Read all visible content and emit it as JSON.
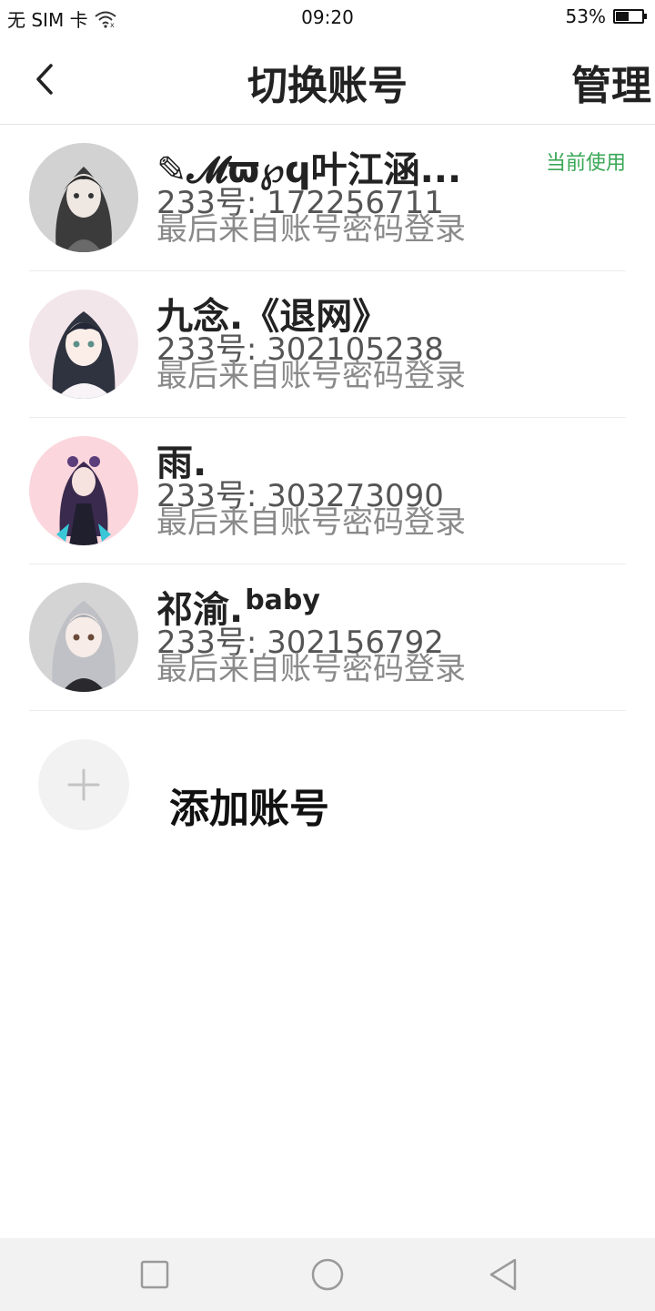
{
  "status_bar": {
    "carrier": "无 SIM 卡",
    "time": "09:20",
    "battery_percent": "53%",
    "battery_level": 0.53
  },
  "nav": {
    "title": "切换账号",
    "manage_label": "管理"
  },
  "accounts": [
    {
      "name": "✎𝓜ϖ℘ϥ叶江涵...",
      "name_sup": "",
      "id_line": "233号: 172256711",
      "login_line": "最后来自账号密码登录",
      "badge": "当前使用"
    },
    {
      "name": "九念.《退网》",
      "name_sup": "",
      "id_line": "233号: 302105238",
      "login_line": "最后来自账号密码登录",
      "badge": ""
    },
    {
      "name": "雨.",
      "name_sup": "",
      "id_line": "233号: 303273090",
      "login_line": "最后来自账号密码登录",
      "badge": ""
    },
    {
      "name": "祁渝.",
      "name_sup": "baby",
      "id_line": "233号: 302156792",
      "login_line": "最后来自账号密码登录",
      "badge": ""
    }
  ],
  "add_account": {
    "label": "添加账号",
    "icon": "plus-icon"
  },
  "colors": {
    "accent_green": "#3aa757",
    "text_dark": "#222222",
    "text_gray": "#8a8a8a"
  }
}
